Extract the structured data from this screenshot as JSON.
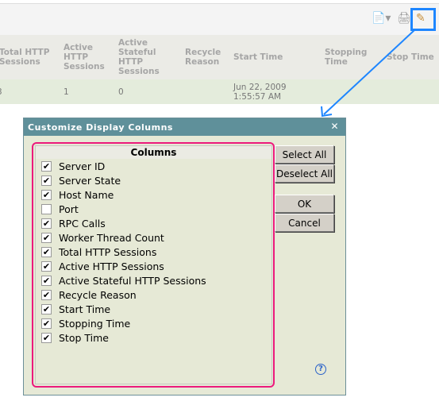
{
  "toolbar": {
    "icons": [
      "export-icon",
      "print-icon",
      "customize-columns-icon"
    ],
    "highlight_color": "#1e86ff"
  },
  "table": {
    "headers": [
      "Total HTTP Sessions",
      "Active HTTP Sessions",
      "Active Stateful HTTP Sessions",
      "Recycle Reason",
      "Start Time",
      "Stopping Time",
      "Stop Time"
    ],
    "row": [
      "3",
      "1",
      "0",
      "",
      "Jun 22, 2009 1:55:57 AM",
      "",
      ""
    ]
  },
  "dialog": {
    "title": "Customize Display Columns",
    "columns_header": "Columns",
    "columns": [
      {
        "label": "Server ID",
        "checked": true
      },
      {
        "label": "Server State",
        "checked": true
      },
      {
        "label": "Host Name",
        "checked": true
      },
      {
        "label": "Port",
        "checked": false
      },
      {
        "label": "RPC Calls",
        "checked": true
      },
      {
        "label": "Worker Thread Count",
        "checked": true
      },
      {
        "label": "Total HTTP Sessions",
        "checked": true
      },
      {
        "label": "Active HTTP Sessions",
        "checked": true
      },
      {
        "label": "Active Stateful HTTP Sessions",
        "checked": true
      },
      {
        "label": "Recycle Reason",
        "checked": true
      },
      {
        "label": "Start Time",
        "checked": true
      },
      {
        "label": "Stopping Time",
        "checked": true
      },
      {
        "label": "Stop Time",
        "checked": true
      }
    ],
    "select_all": "Select All",
    "deselect_all": "Deselect All",
    "ok": "OK",
    "cancel": "Cancel",
    "help": "?",
    "close": "✕"
  }
}
